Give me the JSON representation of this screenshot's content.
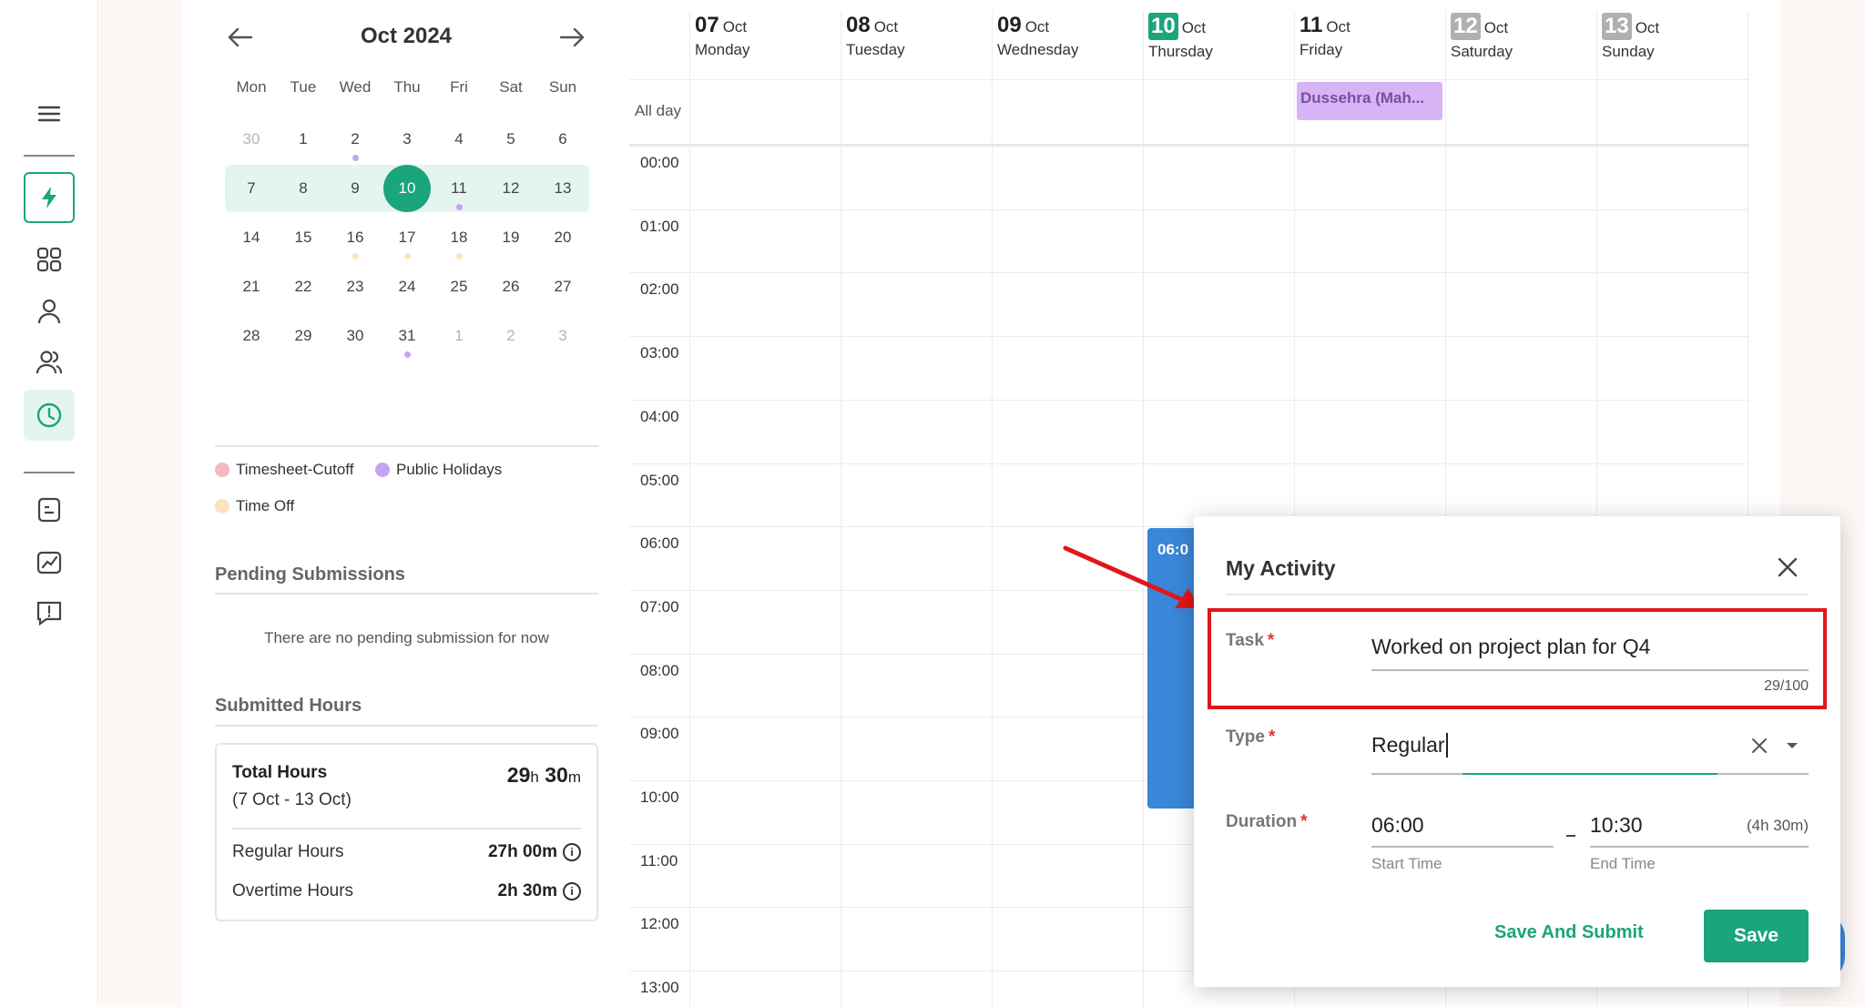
{
  "colors": {
    "accent": "#1aa57c",
    "week_highlight": "#e4f5ef",
    "event_blue": "#3a86d8",
    "holiday": "#d7b4f5",
    "annotation_red": "#e2151b",
    "timesheet_cutoff": "#f4b8c2",
    "public_holidays": "#c6a3f2",
    "time_off": "#fce2bd"
  },
  "rail": {
    "icons": [
      "menu-icon",
      "lightning-icon",
      "grid-icon",
      "user-icon",
      "users-icon",
      "clock-icon",
      "note-icon",
      "chart-icon",
      "feedback-icon"
    ]
  },
  "calendar": {
    "month_label": "Oct  2024",
    "weekdays": [
      "Mon",
      "Tue",
      "Wed",
      "Thu",
      "Fri",
      "Sat",
      "Sun"
    ],
    "weeks": [
      [
        {
          "d": "30",
          "m": true
        },
        {
          "d": "1"
        },
        {
          "d": "2",
          "dot": "public_holidays"
        },
        {
          "d": "3"
        },
        {
          "d": "4"
        },
        {
          "d": "5"
        },
        {
          "d": "6"
        }
      ],
      [
        {
          "d": "7"
        },
        {
          "d": "8"
        },
        {
          "d": "9"
        },
        {
          "d": "10",
          "today": true
        },
        {
          "d": "11",
          "dot": "public_holidays"
        },
        {
          "d": "12"
        },
        {
          "d": "13"
        }
      ],
      [
        {
          "d": "14"
        },
        {
          "d": "15"
        },
        {
          "d": "16",
          "dot": "time_off"
        },
        {
          "d": "17",
          "dot": "time_off"
        },
        {
          "d": "18",
          "dot": "time_off"
        },
        {
          "d": "19"
        },
        {
          "d": "20"
        }
      ],
      [
        {
          "d": "21"
        },
        {
          "d": "22"
        },
        {
          "d": "23"
        },
        {
          "d": "24"
        },
        {
          "d": "25"
        },
        {
          "d": "26"
        },
        {
          "d": "27"
        }
      ],
      [
        {
          "d": "28"
        },
        {
          "d": "29"
        },
        {
          "d": "30"
        },
        {
          "d": "31",
          "dot": "public_holidays"
        },
        {
          "d": "1",
          "m": true
        },
        {
          "d": "2",
          "m": true
        },
        {
          "d": "3",
          "m": true
        }
      ]
    ]
  },
  "legend": {
    "timesheet_cutoff": "Timesheet-Cutoff",
    "public_holidays": "Public Holidays",
    "time_off": "Time Off"
  },
  "pending": {
    "title": "Pending Submissions",
    "empty": "There are no pending submission for now"
  },
  "submitted": {
    "title": "Submitted Hours",
    "total_label": "Total Hours",
    "range": "(7 Oct - 13 Oct)",
    "total_h": "29",
    "total_m": "30",
    "regular_label": "Regular Hours",
    "regular_value": "27h 00m",
    "overtime_label": "Overtime Hours",
    "overtime_value": "2h 30m"
  },
  "week": {
    "days": [
      {
        "num": "07",
        "mon": "Oct",
        "wd": "Monday"
      },
      {
        "num": "08",
        "mon": "Oct",
        "wd": "Tuesday"
      },
      {
        "num": "09",
        "mon": "Oct",
        "wd": "Wednesday"
      },
      {
        "num": "10",
        "mon": "Oct",
        "wd": "Thursday",
        "box": "#1aa57c"
      },
      {
        "num": "11",
        "mon": "Oct",
        "wd": "Friday"
      },
      {
        "num": "12",
        "mon": "Oct",
        "wd": "Saturday",
        "box": "#b0b0b0"
      },
      {
        "num": "13",
        "mon": "Oct",
        "wd": "Sunday",
        "box": "#b0b0b0"
      }
    ],
    "all_day_label": "All day",
    "hours": [
      "00:00",
      "01:00",
      "02:00",
      "03:00",
      "04:00",
      "05:00",
      "06:00",
      "07:00",
      "08:00",
      "09:00",
      "10:00",
      "11:00",
      "12:00",
      "13:00"
    ],
    "holiday_event": "Dussehra (Mah...",
    "event_label": "06:0"
  },
  "modal": {
    "title": "My Activity",
    "task_label": "Task",
    "task_value": "Worked on project plan for Q4",
    "task_counter": "29/100",
    "type_label": "Type",
    "type_value": "Regular",
    "duration_label": "Duration",
    "start_time": "06:00",
    "end_time": "10:30",
    "duration_total": "(4h 30m)",
    "start_caption": "Start Time",
    "end_caption": "End Time",
    "save_submit": "Save And Submit",
    "save": "Save"
  }
}
